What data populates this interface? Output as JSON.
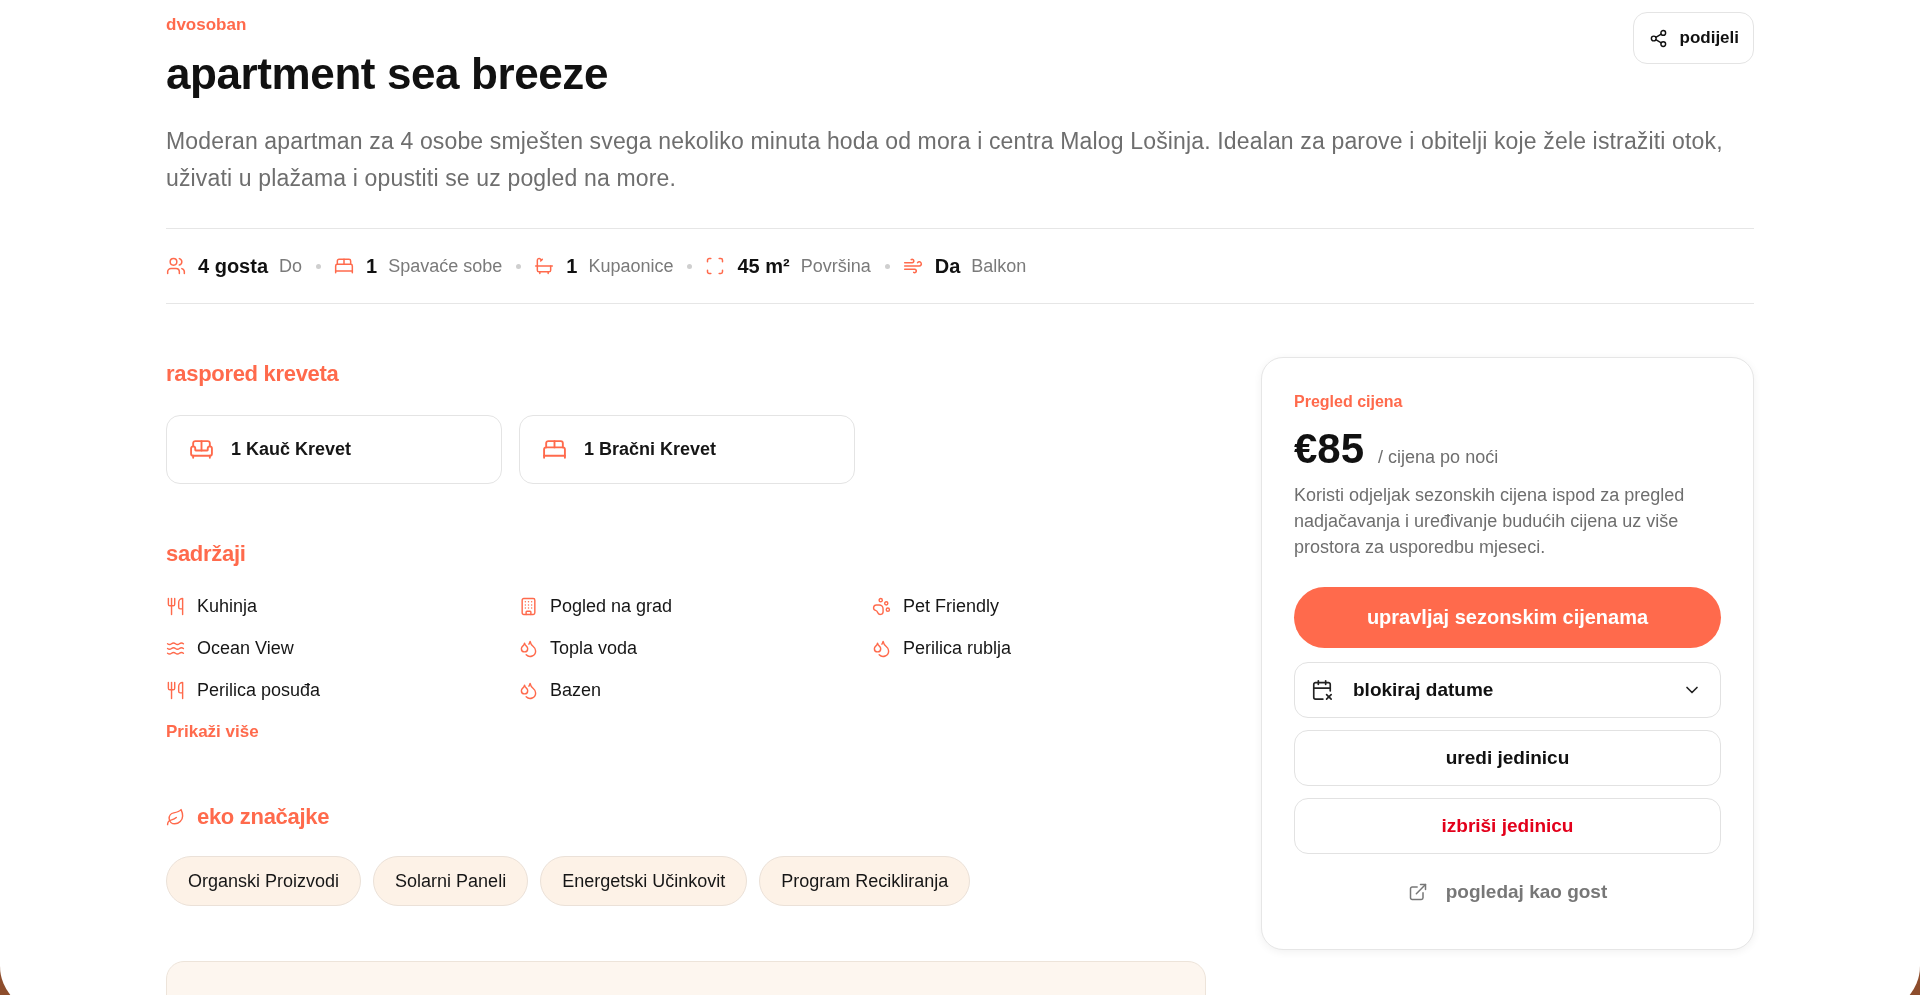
{
  "header": {
    "category": "dvosoban",
    "title": "apartment sea breeze",
    "share_button": "podijeli",
    "description": "Moderan apartman za 4 osobe smješten svega nekoliko minuta hoda od mora i centra Malog Lošinja. Idealan za parove i obitelji koje žele istražiti otok, uživati u plažama i opustiti se uz pogled na more."
  },
  "stats": [
    {
      "kind": "guests",
      "value": "4 gosta",
      "label": "Do"
    },
    {
      "kind": "bedrooms",
      "value": "1",
      "label": "Spavaće sobe"
    },
    {
      "kind": "bathrooms",
      "value": "1",
      "label": "Kupaonice"
    },
    {
      "kind": "area",
      "value": "45 m²",
      "label": "Površina"
    },
    {
      "kind": "balcony",
      "value": "Da",
      "label": "Balkon"
    }
  ],
  "bed_arrangement": {
    "heading": "raspored kreveta",
    "beds": [
      {
        "kind": "sofa-bed",
        "label": "1 Kauč Krevet"
      },
      {
        "kind": "double-bed",
        "label": "1 Bračni Krevet"
      }
    ]
  },
  "amenities": {
    "heading": "sadržaji",
    "items": [
      {
        "kind": "kitchen",
        "label": "Kuhinja"
      },
      {
        "kind": "city",
        "label": "Pogled na grad"
      },
      {
        "kind": "pet",
        "label": "Pet Friendly"
      },
      {
        "kind": "sea",
        "label": "Ocean View"
      },
      {
        "kind": "water",
        "label": "Topla voda"
      },
      {
        "kind": "water",
        "label": "Perilica rublja"
      },
      {
        "kind": "kitchen",
        "label": "Perilica posuđa"
      },
      {
        "kind": "water",
        "label": "Bazen"
      }
    ],
    "show_more": "Prikaži više"
  },
  "eco_features": {
    "heading": "eko značajke",
    "tags": [
      "Organski Proizvodi",
      "Solarni Paneli",
      "Energetski Učinkovit",
      "Program Recikliranja"
    ]
  },
  "pricing": {
    "heading": "Pregled cijena",
    "price": "€85",
    "unit": "/ cijena po noći",
    "note": "Koristi odjeljak sezonskih cijena ispod za pregled nadjačavanja i uređivanje budućih cijena uz više prostora za usporedbu mjeseci.",
    "actions": [
      {
        "kind": "primary",
        "label": "upravljaj sezonskim cijenama"
      },
      {
        "kind": "dropdown",
        "label": "blokiraj datume"
      },
      {
        "kind": "secondary",
        "label": "uredi jedinicu"
      },
      {
        "kind": "danger",
        "label": "izbriši jedinicu"
      },
      {
        "kind": "link",
        "label": "pogledaj kao gost"
      }
    ]
  }
}
